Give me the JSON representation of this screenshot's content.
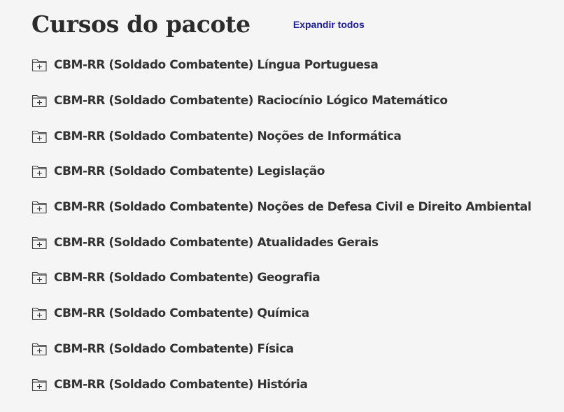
{
  "header": {
    "title": "Cursos do pacote",
    "expand_all_label": "Expandir todos"
  },
  "colors": {
    "background": "#f5f5f5",
    "text": "#333333",
    "link": "#1a1aa6"
  },
  "icon": "folder-plus-icon",
  "courses": [
    {
      "label": "CBM-RR (Soldado Combatente) Língua Portuguesa"
    },
    {
      "label": "CBM-RR (Soldado Combatente) Raciocínio Lógico Matemático"
    },
    {
      "label": "CBM-RR (Soldado Combatente) Noções de Informática"
    },
    {
      "label": "CBM-RR (Soldado Combatente) Legislação"
    },
    {
      "label": "CBM-RR (Soldado Combatente) Noções de Defesa Civil e Direito Ambiental"
    },
    {
      "label": "CBM-RR (Soldado Combatente) Atualidades Gerais"
    },
    {
      "label": "CBM-RR (Soldado Combatente) Geografia"
    },
    {
      "label": "CBM-RR (Soldado Combatente) Química"
    },
    {
      "label": "CBM-RR (Soldado Combatente) Física"
    },
    {
      "label": "CBM-RR (Soldado Combatente) História"
    }
  ]
}
